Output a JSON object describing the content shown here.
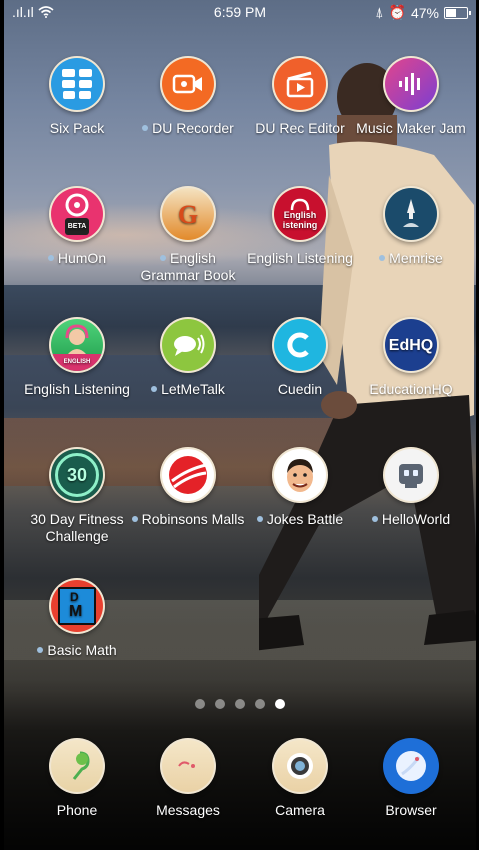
{
  "status_bar": {
    "signal": ".ıl.ıl",
    "time": "6:59 PM",
    "battery_percent": "47%",
    "battery_level": 0.47
  },
  "apps": [
    {
      "label": "Six Pack",
      "dot": false
    },
    {
      "label": "DU Recorder",
      "dot": true
    },
    {
      "label": "DU Rec Editor",
      "dot": false
    },
    {
      "label": "Music Maker Jam",
      "dot": false
    },
    {
      "label": "HumOn",
      "dot": true
    },
    {
      "label": "English Grammar Book",
      "dot": true
    },
    {
      "label": "English Listening",
      "dot": false
    },
    {
      "label": "Memrise",
      "dot": true
    },
    {
      "label": "English Listening",
      "dot": false
    },
    {
      "label": "LetMeTalk",
      "dot": true
    },
    {
      "label": "Cuedin",
      "dot": false
    },
    {
      "label": "EducationHQ",
      "dot": false
    },
    {
      "label": "30 Day Fitness Challenge",
      "dot": false
    },
    {
      "label": "Robinsons Malls",
      "dot": true
    },
    {
      "label": "Jokes Battle",
      "dot": true
    },
    {
      "label": "HelloWorld",
      "dot": true
    },
    {
      "label": "Basic Math",
      "dot": true
    }
  ],
  "icon_text": {
    "beta": "BETA",
    "english_listening_line1": "English",
    "english_listening_line2": "istening",
    "english_small": "ENGLISH",
    "edhq": "EdHQ",
    "thirty": "30",
    "d": "D",
    "m": "M"
  },
  "pager": {
    "pages": 5,
    "current": 5
  },
  "dock": [
    {
      "label": "Phone"
    },
    {
      "label": "Messages"
    },
    {
      "label": "Camera"
    },
    {
      "label": "Browser"
    }
  ]
}
